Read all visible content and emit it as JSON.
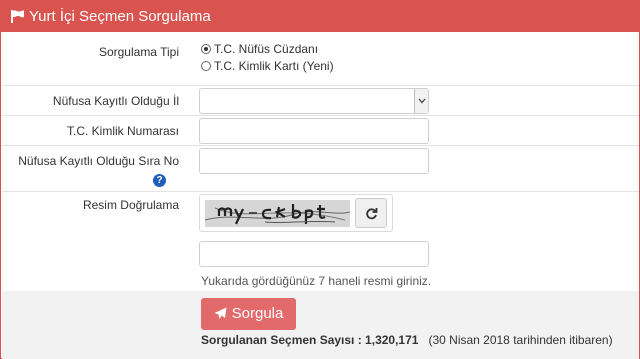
{
  "header": {
    "title": "Yurt İçi Seçmen Sorgulama",
    "icon": "flag-icon",
    "color": "#d9534f"
  },
  "form": {
    "query_type": {
      "label": "Sorgulama Tipi",
      "options": [
        "T.C. Nüfüs Cüzdanı",
        "T.C. Kimlik Kartı (Yeni)"
      ],
      "selected": "T.C. Nüfüs Cüzdanı"
    },
    "province": {
      "label": "Nüfusa Kayıtlı Olduğu İl",
      "value": ""
    },
    "tc_number": {
      "label": "T.C. Kimlik Numarası",
      "value": ""
    },
    "sequence_number": {
      "label": "Nüfusa Kayıtlı Olduğu Sıra No",
      "value": "",
      "help_icon": "question-circle-icon"
    },
    "captcha": {
      "label": "Resim Doğrulama",
      "refresh_icon": "refresh-icon",
      "input_value": "",
      "hint": "Yukarıda gördüğünüz 7 haneli resmi giriniz."
    }
  },
  "footer": {
    "submit_label": "Sorgula",
    "submit_color": "#e26a6a",
    "count_label": "Sorgulanan Seçmen Sayısı : 1,320,171",
    "count_note": "(30 Nisan 2018 tarihinden itibaren)"
  }
}
